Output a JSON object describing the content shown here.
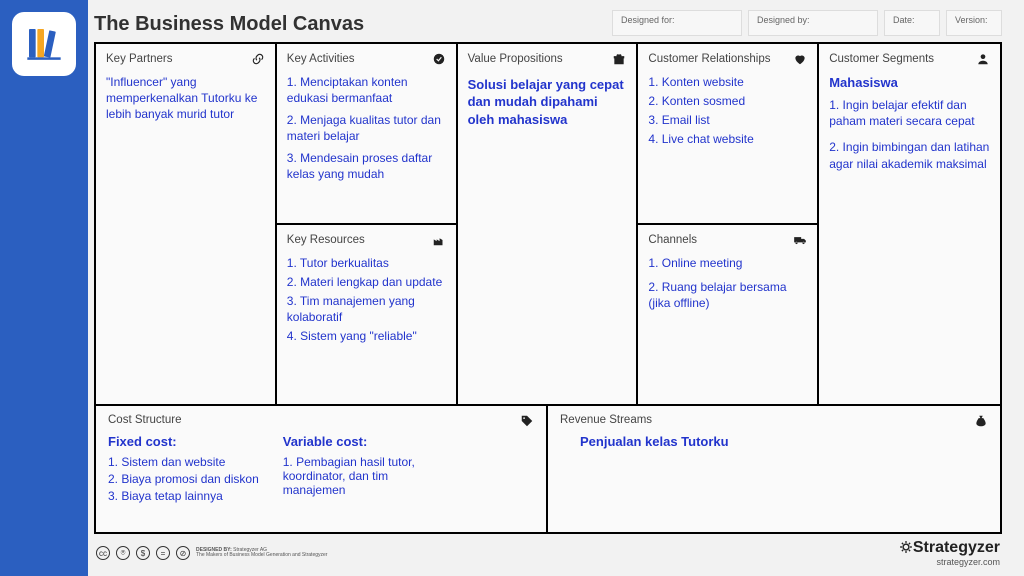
{
  "title": "The Business Model Canvas",
  "meta": {
    "designed_for": "Designed for:",
    "designed_by": "Designed by:",
    "date": "Date:",
    "version": "Version:"
  },
  "cells": {
    "partners": {
      "title": "Key Partners",
      "body": "\"Influencer\" yang memperkenalkan Tutorku ke lebih banyak murid tutor"
    },
    "activities": {
      "title": "Key Activities",
      "items": [
        "1. Menciptakan konten edukasi bermanfaat",
        "2. Menjaga kualitas tutor dan materi belajar",
        "3. Mendesain proses daftar kelas yang mudah"
      ]
    },
    "resources": {
      "title": "Key Resources",
      "items": [
        "1. Tutor berkualitas",
        "2. Materi lengkap dan update",
        "3. Tim manajemen yang kolaboratif",
        "4. Sistem yang \"reliable\""
      ]
    },
    "value": {
      "title": "Value Propositions",
      "body": "Solusi belajar yang cepat dan mudah dipahami oleh mahasiswa"
    },
    "relationships": {
      "title": "Customer Relationships",
      "items": [
        "1.  Konten website",
        "2. Konten sosmed",
        "3. Email list",
        "4. Live chat website"
      ]
    },
    "channels": {
      "title": "Channels",
      "items": [
        "1. Online meeting",
        "2. Ruang belajar bersama (jika offline)"
      ]
    },
    "segments": {
      "title": "Customer Segments",
      "heading": "Mahasiswa",
      "items": [
        "1. Ingin belajar efektif dan paham materi secara cepat",
        "2. Ingin bimbingan dan latihan agar nilai akademik maksimal"
      ]
    },
    "cost": {
      "title": "Cost Structure",
      "fixed_label": "Fixed cost:",
      "fixed_items": [
        "1. Sistem dan website",
        "2. Biaya promosi dan diskon",
        "3. Biaya tetap lainnya"
      ],
      "variable_label": "Variable cost:",
      "variable_items": [
        "1. Pembagian hasil tutor, koordinator, dan tim manajemen"
      ]
    },
    "revenue": {
      "title": "Revenue Streams",
      "body": "Penjualan kelas Tutorku"
    }
  },
  "footer": {
    "designed_by_label": "DESIGNED BY:",
    "designed_by_value": "Strategyzer AG",
    "tagline": "The Makers of Business Model Generation and Strategyzer",
    "brand": "Strategyzer",
    "url": "strategyzer.com"
  }
}
